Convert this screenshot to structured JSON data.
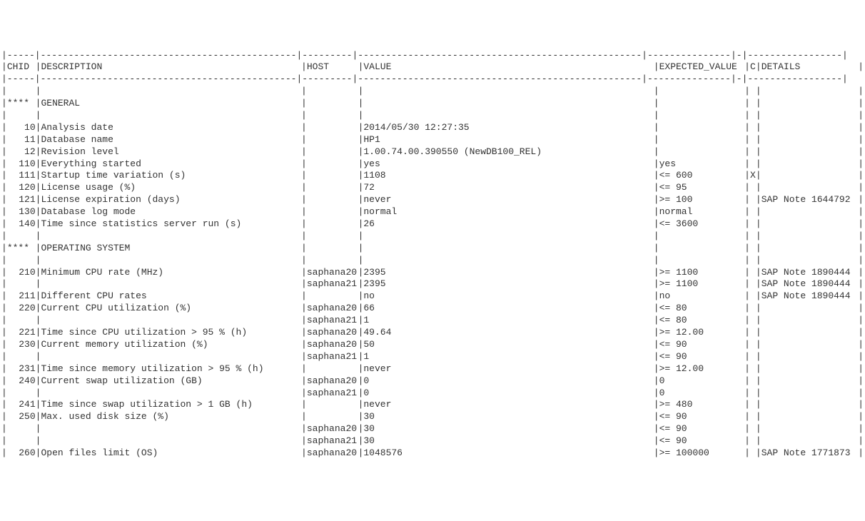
{
  "headers": {
    "chid": "CHID",
    "description": "DESCRIPTION",
    "host": "HOST",
    "value": "VALUE",
    "expected_value": "EXPECTED_VALUE",
    "c": "C",
    "details": "DETAILS"
  },
  "section_marker": "****",
  "dash_char": "-",
  "sections": [
    {
      "title": "GENERAL",
      "rows": [
        {
          "chid": "10",
          "description": "Analysis date",
          "host": "",
          "value": "2014/05/30 12:27:35",
          "expected_value": "",
          "c": "",
          "details": ""
        },
        {
          "chid": "11",
          "description": "Database name",
          "host": "",
          "value": "HP1",
          "expected_value": "",
          "c": "",
          "details": ""
        },
        {
          "chid": "12",
          "description": "Revision level",
          "host": "",
          "value": "1.00.74.00.390550 (NewDB100_REL)",
          "expected_value": "",
          "c": "",
          "details": ""
        },
        {
          "chid": "110",
          "description": "Everything started",
          "host": "",
          "value": "yes",
          "expected_value": "yes",
          "c": "",
          "details": ""
        },
        {
          "chid": "111",
          "description": "Startup time variation (s)",
          "host": "",
          "value": "1108",
          "expected_value": "<= 600",
          "c": "X",
          "details": ""
        },
        {
          "chid": "120",
          "description": "License usage (%)",
          "host": "",
          "value": "72",
          "expected_value": "<= 95",
          "c": "",
          "details": ""
        },
        {
          "chid": "121",
          "description": "License expiration (days)",
          "host": "",
          "value": "never",
          "expected_value": ">= 100",
          "c": "",
          "details": "SAP Note 1644792"
        },
        {
          "chid": "130",
          "description": "Database log mode",
          "host": "",
          "value": "normal",
          "expected_value": "normal",
          "c": "",
          "details": ""
        },
        {
          "chid": "140",
          "description": "Time since statistics server run (s)",
          "host": "",
          "value": "26",
          "expected_value": "<= 3600",
          "c": "",
          "details": ""
        }
      ]
    },
    {
      "title": "OPERATING SYSTEM",
      "rows": [
        {
          "chid": "210",
          "description": "Minimum CPU rate (MHz)",
          "host": "saphana20",
          "value": "2395",
          "expected_value": ">= 1100",
          "c": "",
          "details": "SAP Note 1890444"
        },
        {
          "chid": "",
          "description": "",
          "host": "saphana21",
          "value": "2395",
          "expected_value": ">= 1100",
          "c": "",
          "details": "SAP Note 1890444"
        },
        {
          "chid": "211",
          "description": "Different CPU rates",
          "host": "",
          "value": "no",
          "expected_value": "no",
          "c": "",
          "details": "SAP Note 1890444"
        },
        {
          "chid": "220",
          "description": "Current CPU utilization (%)",
          "host": "saphana20",
          "value": "66",
          "expected_value": "<= 80",
          "c": "",
          "details": ""
        },
        {
          "chid": "",
          "description": "",
          "host": "saphana21",
          "value": "1",
          "expected_value": "<= 80",
          "c": "",
          "details": ""
        },
        {
          "chid": "221",
          "description": "Time since CPU utilization > 95 % (h)",
          "host": "saphana20",
          "value": "49.64",
          "expected_value": ">= 12.00",
          "c": "",
          "details": ""
        },
        {
          "chid": "230",
          "description": "Current memory utilization (%)",
          "host": "saphana20",
          "value": "50",
          "expected_value": "<= 90",
          "c": "",
          "details": ""
        },
        {
          "chid": "",
          "description": "",
          "host": "saphana21",
          "value": "1",
          "expected_value": "<= 90",
          "c": "",
          "details": ""
        },
        {
          "chid": "231",
          "description": "Time since memory utilization > 95 % (h)",
          "host": "",
          "value": "never",
          "expected_value": ">= 12.00",
          "c": "",
          "details": ""
        },
        {
          "chid": "240",
          "description": "Current swap utilization (GB)",
          "host": "saphana20",
          "value": "0",
          "expected_value": "0",
          "c": "",
          "details": ""
        },
        {
          "chid": "",
          "description": "",
          "host": "saphana21",
          "value": "0",
          "expected_value": "0",
          "c": "",
          "details": ""
        },
        {
          "chid": "241",
          "description": "Time since swap utilization > 1 GB (h)",
          "host": "",
          "value": "never",
          "expected_value": ">= 480",
          "c": "",
          "details": ""
        },
        {
          "chid": "250",
          "description": "Max. used disk size (%)",
          "host": "",
          "value": "30",
          "expected_value": "<= 90",
          "c": "",
          "details": ""
        },
        {
          "chid": "",
          "description": "",
          "host": "saphana20",
          "value": "30",
          "expected_value": "<= 90",
          "c": "",
          "details": ""
        },
        {
          "chid": "",
          "description": "",
          "host": "saphana21",
          "value": "30",
          "expected_value": "<= 90",
          "c": "",
          "details": ""
        },
        {
          "chid": "260",
          "description": "Open files limit (OS)",
          "host": "saphana20",
          "value": "1048576",
          "expected_value": ">= 100000",
          "c": "",
          "details": "SAP Note 1771873"
        }
      ]
    }
  ]
}
